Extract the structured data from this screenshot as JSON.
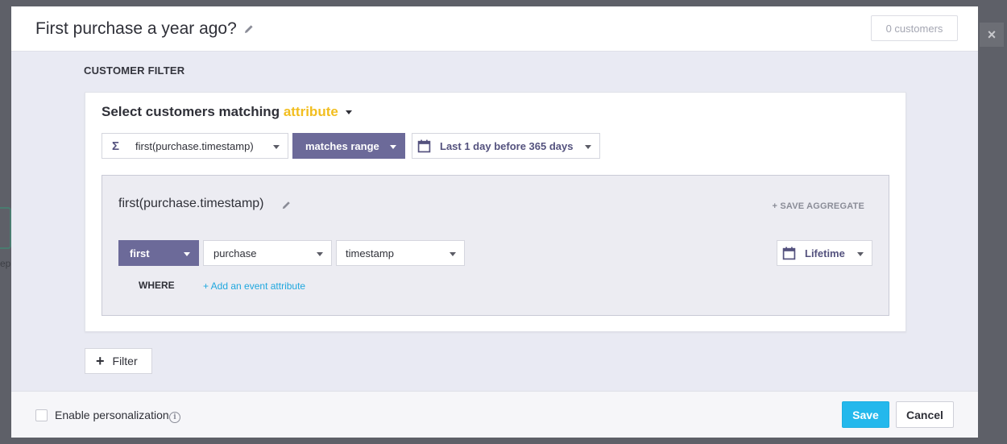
{
  "background": {
    "partial_text": "ep"
  },
  "overlay": {
    "close_glyph": "×"
  },
  "header": {
    "title": "First purchase a year ago?",
    "customer_count": "0 customers"
  },
  "filter_section": {
    "label": "CUSTOMER FILTER",
    "match_prefix": "Select customers matching",
    "match_type": "attribute",
    "attribute_dropdown": "first(purchase.timestamp)",
    "operator_dropdown": "matches range",
    "range_dropdown": "Last 1 day before 365 days",
    "aggregate": {
      "title": "first(purchase.timestamp)",
      "save_label": "+ SAVE AGGREGATE",
      "function_dropdown": "first",
      "event_dropdown": "purchase",
      "property_dropdown": "timestamp",
      "time_window_dropdown": "Lifetime",
      "where_label": "WHERE",
      "add_attribute_link": "+ Add an event attribute"
    }
  },
  "add_filter_button": {
    "icon": "+",
    "label": "Filter"
  },
  "footer": {
    "personalization_label": "Enable personalization",
    "info_glyph": "i",
    "save_label": "Save",
    "cancel_label": "Cancel"
  },
  "colors": {
    "accent_yellow": "#f2be1f",
    "primary_purple": "#6c6a99",
    "link_blue": "#1fa7de",
    "save_blue": "#24b8ec"
  }
}
